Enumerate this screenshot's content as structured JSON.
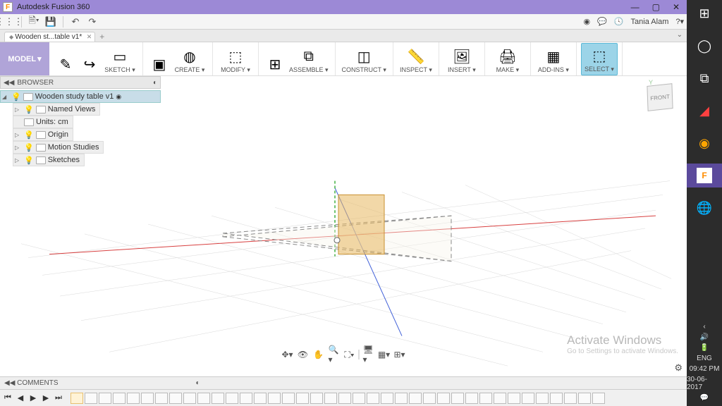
{
  "titlebar": {
    "app_name": "Autodesk Fusion 360",
    "icon_letter": "F"
  },
  "quickbar": {
    "user": "Tania Alam"
  },
  "file_tab": {
    "label": "Wooden st...table v1*"
  },
  "ribbon": {
    "model": "MODEL",
    "groups": [
      {
        "label": "SKETCH",
        "icons": [
          {
            "name": "sketch-icon",
            "glyph": "✎"
          },
          {
            "name": "line-icon",
            "glyph": "↪"
          },
          {
            "name": "rect-icon",
            "glyph": "▭"
          }
        ]
      },
      {
        "label": "CREATE",
        "icons": [
          {
            "name": "extrude-icon",
            "glyph": "▣"
          },
          {
            "name": "sphere-icon",
            "glyph": "◍"
          }
        ]
      },
      {
        "label": "MODIFY",
        "icons": [
          {
            "name": "modify-icon",
            "glyph": "⬚"
          }
        ]
      },
      {
        "label": "ASSEMBLE",
        "icons": [
          {
            "name": "component-icon",
            "glyph": "⊞"
          },
          {
            "name": "joint-icon",
            "glyph": "⧉"
          }
        ]
      },
      {
        "label": "CONSTRUCT",
        "icons": [
          {
            "name": "plane-icon",
            "glyph": "◫"
          }
        ]
      },
      {
        "label": "INSPECT",
        "icons": [
          {
            "name": "measure-icon",
            "glyph": "📏"
          }
        ]
      },
      {
        "label": "INSERT",
        "icons": [
          {
            "name": "insert-icon",
            "glyph": "🖼"
          }
        ]
      },
      {
        "label": "MAKE",
        "icons": [
          {
            "name": "make-icon",
            "glyph": "🖨"
          }
        ]
      },
      {
        "label": "ADD-INS",
        "icons": [
          {
            "name": "addins-icon",
            "glyph": "▦"
          }
        ]
      },
      {
        "label": "SELECT",
        "icons": [
          {
            "name": "select-icon",
            "glyph": "⬚"
          }
        ],
        "active": true
      }
    ]
  },
  "browser": {
    "header": "BROWSER",
    "root": "Wooden study table v1",
    "items": [
      {
        "label": "Named Views"
      },
      {
        "label": "Units: cm",
        "no_expand": true
      },
      {
        "label": "Origin"
      },
      {
        "label": "Motion Studies"
      },
      {
        "label": "Sketches"
      }
    ]
  },
  "viewcube": {
    "face": "FRONT"
  },
  "comments": {
    "label": "COMMENTS"
  },
  "watermark": {
    "title": "Activate Windows",
    "sub": "Go to Settings to activate Windows."
  },
  "win_tray": {
    "lang": "ENG",
    "time": "09:42 PM",
    "date": "30-06-2017"
  }
}
